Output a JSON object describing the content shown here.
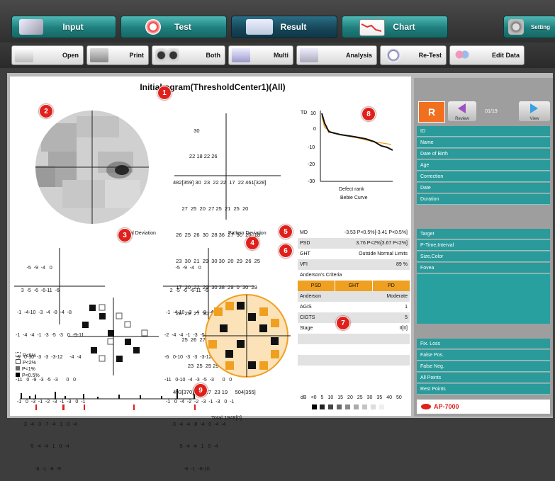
{
  "nav": {
    "input": "Input",
    "test": "Test",
    "result": "Result",
    "chart": "Chart",
    "setting": "Setting"
  },
  "toolbar": {
    "open": "Open",
    "print": "Print",
    "both": "Both",
    "multi": "Multi",
    "analysis": "Analysis",
    "retest": "Re-Test",
    "edit_data": "Edit Data"
  },
  "report": {
    "title": "Initial    ogram(ThresholdCenter1)(All)",
    "total_deviation": "Total Deviation",
    "pattern_deviation": "Pattern Deviation",
    "defect_rank": "Defect rank",
    "bebie_curve": "Bebie Curve",
    "td_label": "TD",
    "bebie_ticks": [
      "10",
      "0",
      "-10",
      "-20",
      "-30"
    ],
    "threshold_rows": [
      "              30",
      "           22 18 22 26",
      "482[359] 30  23  22 22  17  22 461[328]",
      "      27  25  20  27 25  21  25  20",
      "  26  25  26  30  28 36  27  30  20  18",
      "  23  30  21  29  30 30  20  29  26  25",
      "  17  30  22  29  30 38  29  0  30  29",
      "  26  29  27  30  30 29  30  27  30  28",
      "      25  26  27  23 27  31  27  25",
      "          23  25  25 29  30  25",
      "493[370]  24  27  23 19     504[355]",
      "                          Total 1948[0]"
    ],
    "td_rows": [
      "        -5  -9  -4   0",
      "    3  -5  -6  -6-11  -6",
      " -1  -4-10  -3  -4  -8  -4  -8",
      "-1  -4  -4  -1  -3  -5  -3   0  -9-11",
      "-6   0-10  -3  -3  -3-12     -4  -4",
      "-11   0  -9  -3  -5  -3      0   0",
      " -1   0  -3  -1  -2  -3  -1  -3   0  -1",
      "     -3  -4  -3  -7  -4   1  -3  -4",
      "          -5  -4  -4   1   0  -4",
      "              -6  -1  -6  -9"
    ],
    "pd_rows": [
      "        -5  -9  -4   0",
      "    2  -5  -6  -6-11  -6",
      " -1  -4-10  -3  -4  -8  -4  -9",
      "-2  -4  -4  -1  -3  -5  -3   0  -9-11",
      "-6   0-10  -3  -3  -3-12     -4  -4",
      "-11   0-10  -4  -3  -5  -3      0   0",
      " -1   0  -4  -2  -2  -3  -1  -3   0  -1",
      "     -3  -4  -4  -8  -4   0  -4  -4",
      "          -5  -4  -4   1   0  -4",
      "              -6  -1  -6-10"
    ],
    "legend": [
      "P<5%",
      "P<2%",
      "P<1%",
      "P<0.5%"
    ],
    "db_label": "dB",
    "db_scale": [
      "<0",
      "5",
      "10",
      "15",
      "20",
      "25",
      "30",
      "35",
      "40",
      "50"
    ]
  },
  "stats": {
    "md_label": "MD",
    "md_value": "-3.53 P<0.5%[-3.41 P<0.5%]",
    "psd_label": "PSD",
    "psd_value": "3.76 P<2%[3.67 P<2%]",
    "ght_label": "GHT",
    "ght_value": "Outside Normal Limits",
    "vfi_label": "VFI",
    "vfi_value": "89 %",
    "andersons_criteria": "Anderson's Criteria",
    "crit_psd": "PSD",
    "crit_ght": "GHT",
    "crit_pd": "PD",
    "anderson_label": "Anderson",
    "anderson_value": "Moderate",
    "agis_label": "AGIS",
    "agis_value": "1",
    "cigts_label": "CIGTS",
    "cigts_value": "5",
    "stage_label": "Stage",
    "stage_value": "II[II]"
  },
  "badges": [
    "1",
    "2",
    "3",
    "4",
    "5",
    "6",
    "7",
    "8",
    "9"
  ],
  "side": {
    "eye": "R",
    "review": "Review",
    "counter": "01/19",
    "view": "View",
    "fields": [
      "ID",
      "Name",
      "Date of Birth",
      "Age",
      "Correction",
      "Date",
      "Duration"
    ],
    "fields2": [
      "Target",
      "P-Time,Interval",
      "Size,Color",
      "Fovea"
    ],
    "fields3": [
      "Fix. Loss",
      "False Pos.",
      "False Neg.",
      "All Points",
      "Rest Points"
    ],
    "brand": "AP-7000"
  },
  "colors": {
    "teal": "#2a9a9a",
    "orange": "#f0a021",
    "badge": "#e0201b"
  }
}
